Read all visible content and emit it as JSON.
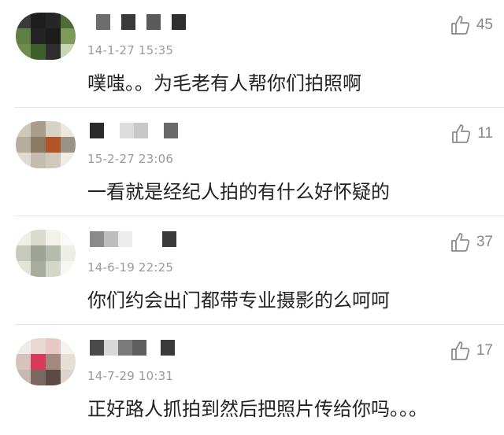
{
  "comments": [
    {
      "time": "14-1-27 15:35",
      "text": "噗嗤。。为毛老有人帮你们拍照啊",
      "likes": "45"
    },
    {
      "time": "15-2-27 23:06",
      "text": "一看就是经纪人拍的有什么好怀疑的",
      "likes": "11"
    },
    {
      "time": "14-6-19 22:25",
      "text": "你们约会出门都带专业摄影的么呵呵",
      "likes": "37"
    },
    {
      "time": "14-7-29 10:31",
      "text": "正好路人抓拍到然后把照片传给你吗。。。",
      "likes": "17"
    }
  ],
  "icons": {
    "like": "thumbs-up-icon"
  },
  "colors": {
    "text": "#222222",
    "meta": "#9a9a9a",
    "likes": "#888888",
    "divider": "#e6e6e6"
  }
}
